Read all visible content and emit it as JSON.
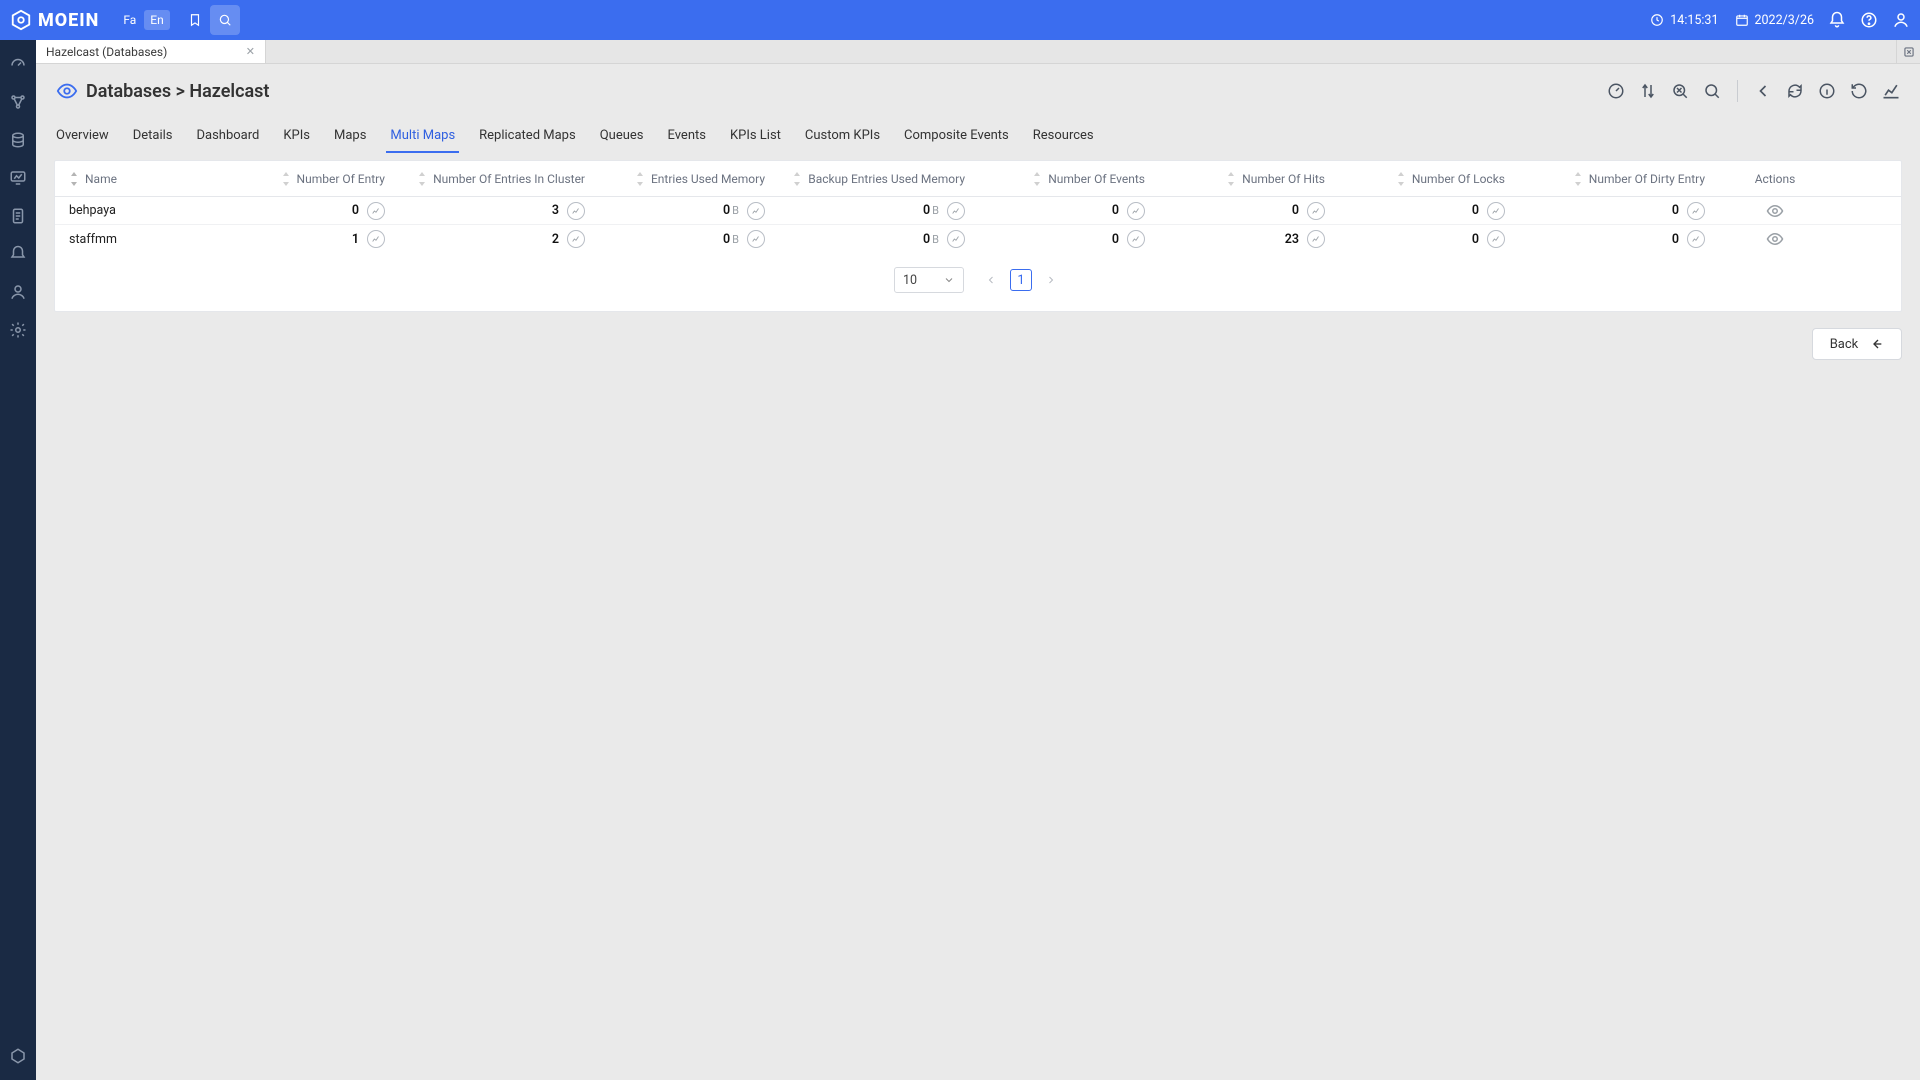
{
  "header": {
    "brand": "MOEIN",
    "lang_fa": "Fa",
    "lang_en": "En",
    "time": "14:15:31",
    "date": "2022/3/26"
  },
  "tab": {
    "title": "Hazelcast (Databases)"
  },
  "breadcrumb": {
    "text": "Databases > Hazelcast"
  },
  "subtabs": [
    "Overview",
    "Details",
    "Dashboard",
    "KPIs",
    "Maps",
    "Multi Maps",
    "Replicated Maps",
    "Queues",
    "Events",
    "KPIs List",
    "Custom KPIs",
    "Composite Events",
    "Resources"
  ],
  "subtab_active_index": 5,
  "columns": {
    "name": "Name",
    "entry": "Number Of Entry",
    "cluster": "Number Of Entries In Cluster",
    "used_mem": "Entries Used Memory",
    "backup_mem": "Backup Entries Used Memory",
    "events": "Number Of Events",
    "hits": "Number Of Hits",
    "locks": "Number Of Locks",
    "dirty": "Number Of Dirty Entry",
    "actions": "Actions"
  },
  "rows": [
    {
      "name": "behpaya",
      "entry": "0",
      "cluster": "3",
      "used_mem": "0",
      "used_mem_unit": "B",
      "backup_mem": "0",
      "backup_mem_unit": "B",
      "events": "0",
      "hits": "0",
      "locks": "0",
      "dirty": "0"
    },
    {
      "name": "staffmm",
      "entry": "1",
      "cluster": "2",
      "used_mem": "0",
      "used_mem_unit": "B",
      "backup_mem": "0",
      "backup_mem_unit": "B",
      "events": "0",
      "hits": "23",
      "locks": "0",
      "dirty": "0"
    }
  ],
  "pager": {
    "size": "10",
    "page": "1"
  },
  "back_label": "Back"
}
